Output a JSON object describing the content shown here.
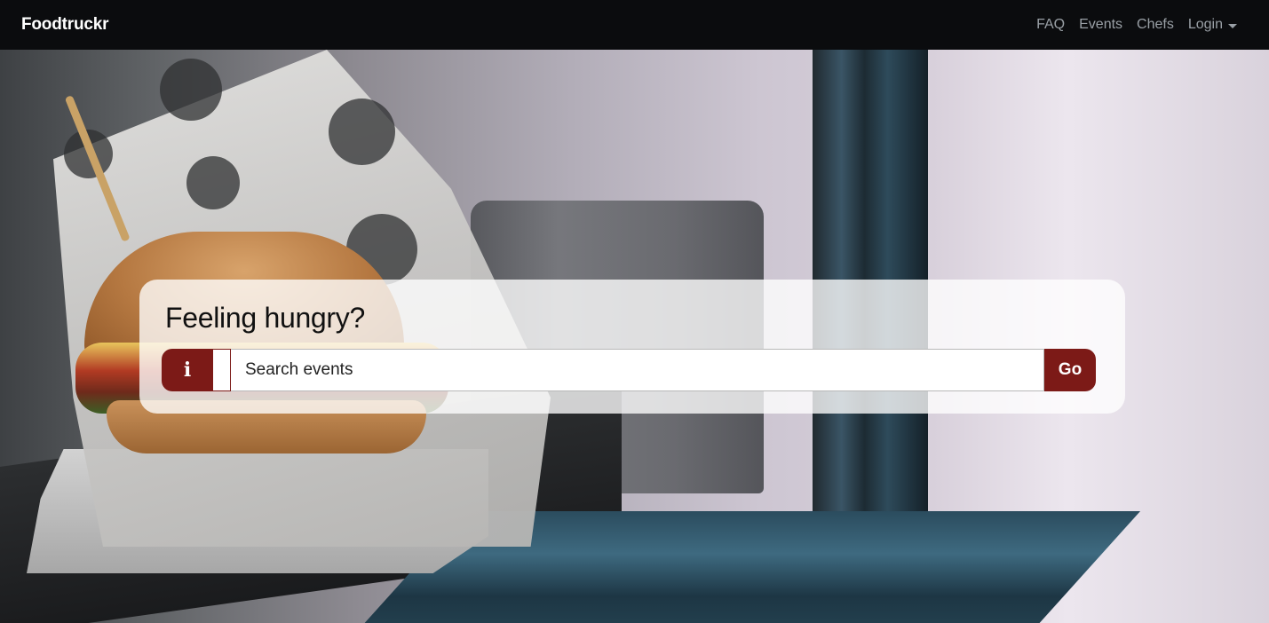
{
  "navbar": {
    "brand": "Foodtruckr",
    "links": [
      {
        "label": "FAQ"
      },
      {
        "label": "Events"
      },
      {
        "label": "Chefs"
      }
    ],
    "dropdown": {
      "label": "Login",
      "icon": "caret-down-icon"
    }
  },
  "hero": {
    "title": "Feeling hungry?",
    "search": {
      "info_icon_glyph": "i",
      "info_icon": "info-icon",
      "placeholder": "Search events",
      "value": "",
      "go_label": "Go"
    },
    "background_image": "burger in food truck paper wrapper on a serving window"
  },
  "colors": {
    "navbar_bg": "#0b0c0e",
    "nav_link": "#9aa0a6",
    "brand_text": "#ffffff",
    "accent": "#7c1a17",
    "card_bg": "rgba(255,255,255,0.78)"
  }
}
